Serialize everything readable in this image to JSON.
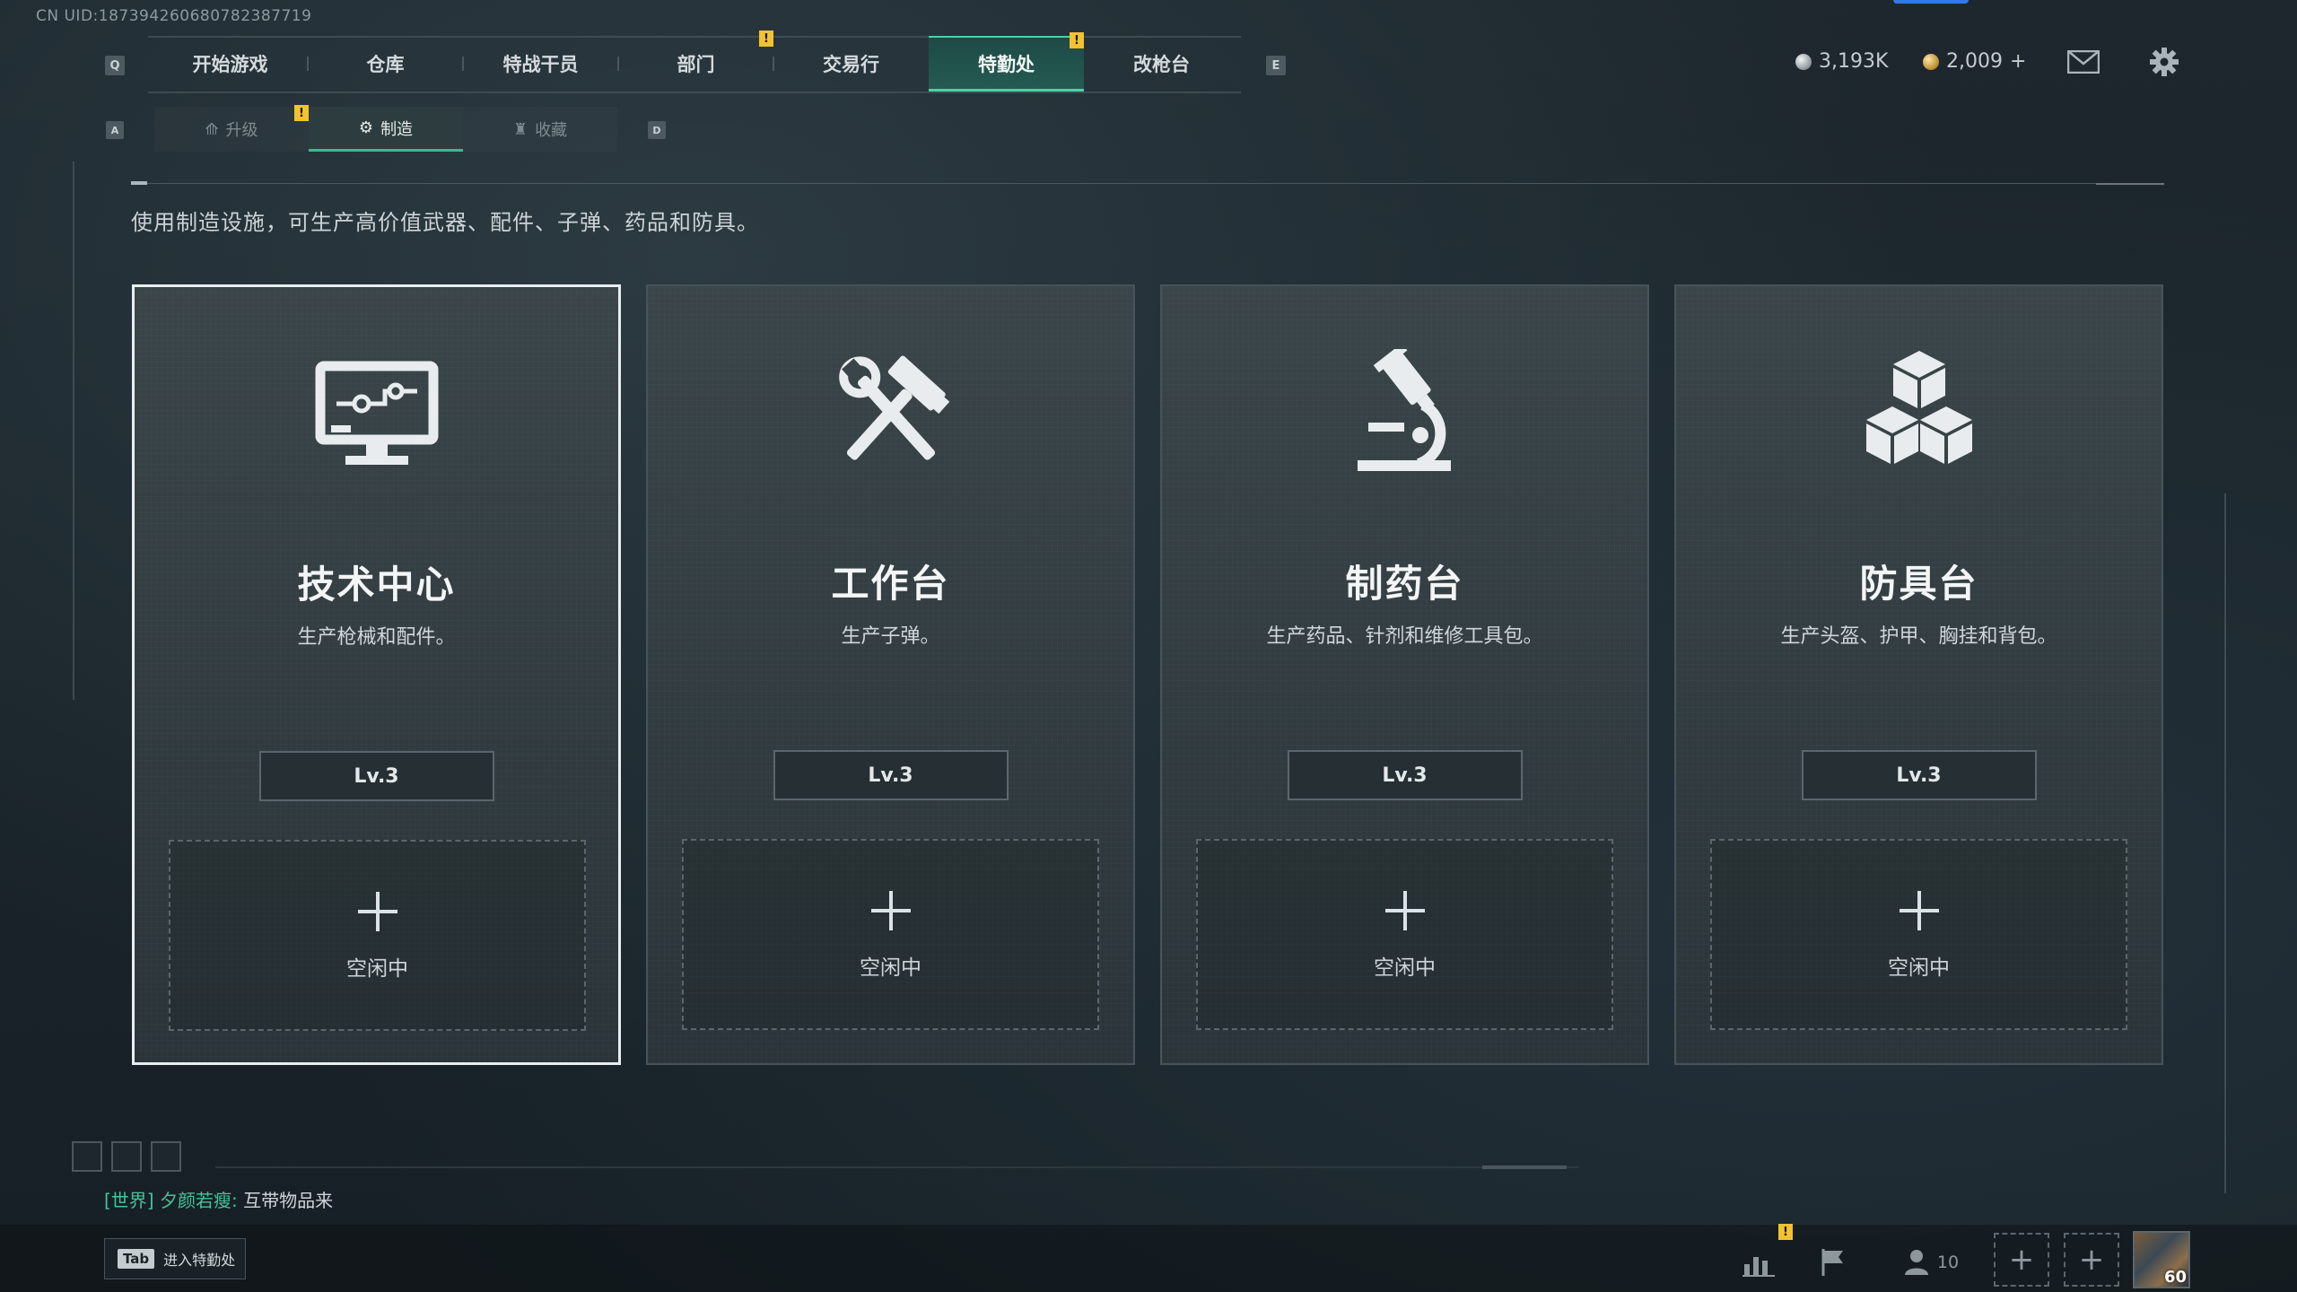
{
  "uid_text": "CN UID:187394260680782387719",
  "top_nav": {
    "key_left": "Q",
    "key_right": "E",
    "tabs": [
      {
        "label": "开始游戏"
      },
      {
        "label": "仓库"
      },
      {
        "label": "特战干员"
      },
      {
        "label": "部门",
        "alert": "!"
      },
      {
        "label": "交易行"
      },
      {
        "label": "特勤处",
        "alert": "!",
        "active": true
      },
      {
        "label": "改枪台"
      }
    ]
  },
  "currency": {
    "silver": "3,193K",
    "gold": "2,009",
    "gold_add": "+"
  },
  "sub_nav": {
    "key_left": "A",
    "key_right": "D",
    "tabs": [
      {
        "label": "升级",
        "alert": "!"
      },
      {
        "label": "制造",
        "active": true
      },
      {
        "label": "收藏"
      }
    ]
  },
  "description": "使用制造设施，可生产高价值武器、配件、子弹、药品和防具。",
  "stations": [
    {
      "title": "技术中心",
      "subtitle": "生产枪械和配件。",
      "level": "Lv.3",
      "slot_status": "空闲中",
      "icon": "computer-icon"
    },
    {
      "title": "工作台",
      "subtitle": "生产子弹。",
      "level": "Lv.3",
      "slot_status": "空闲中",
      "icon": "hammer-wrench-icon"
    },
    {
      "title": "制药台",
      "subtitle": "生产药品、针剂和维修工具包。",
      "level": "Lv.3",
      "slot_status": "空闲中",
      "icon": "microscope-icon"
    },
    {
      "title": "防具台",
      "subtitle": "生产头盔、护甲、胸挂和背包。",
      "level": "Lv.3",
      "slot_status": "空闲中",
      "icon": "cubes-icon"
    }
  ],
  "chat": {
    "channel": "[世界]",
    "name": "夕颜若瘦:",
    "message": "互带物品来"
  },
  "bottom": {
    "tab_key": "Tab",
    "tab_hint": "进入特勤处",
    "alert": "!",
    "friends_count": "10",
    "level_badge": "60"
  },
  "colors": {
    "accent": "#4fd0a3",
    "alert": "#f2c230"
  }
}
